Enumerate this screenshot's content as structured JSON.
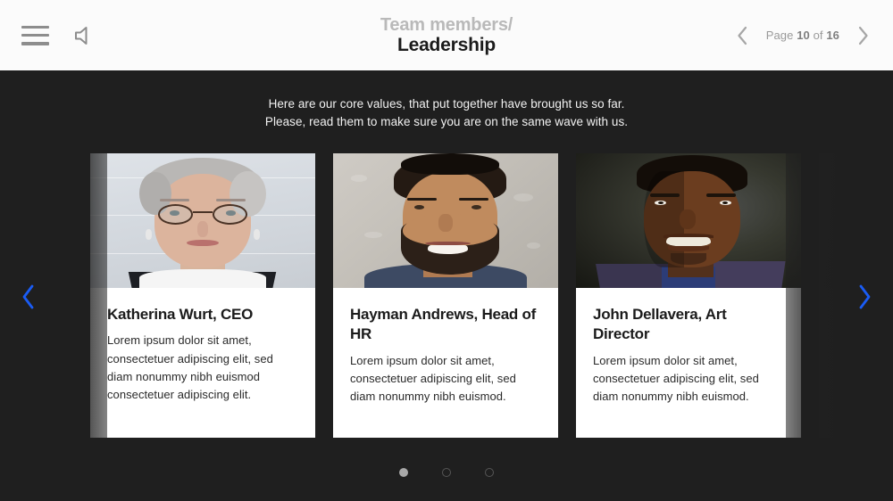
{
  "topbar": {
    "menu_icon": "hamburger-menu-icon",
    "sound_icon": "speaker-icon",
    "title_eyebrow": "Team members/",
    "title_main": "Leadership",
    "prev_icon": "chevron-left-icon",
    "next_icon": "chevron-right-icon",
    "page_prefix": "Page ",
    "page_current": "10",
    "page_middle": " of ",
    "page_total": "16",
    "background_color": "#fbfbfb",
    "title_gray": "#b9b9b9",
    "title_black": "#1b1b1b"
  },
  "slide": {
    "background_color": "#1f1f1f",
    "subtitle_line1": "Here are our core values, that put together have brought us so far.",
    "subtitle_line2": "Please, read them to make sure you are on the same wave with us.",
    "accent_color": "#1a5cf5",
    "card_background": "#ffffff"
  },
  "carousel": {
    "prev_arrow_icon": "chevron-left-icon",
    "next_arrow_icon": "chevron-right-icon",
    "cards": [
      {
        "name": "Katherina Wurt, CEO",
        "description": "Lorem ipsum dolor sit amet, consectetuer adipiscing elit, sed diam nonummy nibh euismod consectetuer adipiscing elit.",
        "photo_alt": "portrait-woman-gray-hair-glasses"
      },
      {
        "name": "Hayman Andrews, Head of HR",
        "description": "Lorem ipsum dolor sit amet, consectetuer adipiscing elit, sed diam nonummy nibh euismod.",
        "photo_alt": "portrait-bearded-man-smiling"
      },
      {
        "name": "John Dellavera, Art Director",
        "description": "Lorem ipsum dolor sit amet, consectetuer adipiscing elit, sed diam nonummy nibh euismod.",
        "photo_alt": "portrait-young-man-suit-smiling"
      }
    ],
    "dots": [
      {
        "state": "active"
      },
      {
        "state": "inactive"
      },
      {
        "state": "inactive"
      }
    ]
  }
}
